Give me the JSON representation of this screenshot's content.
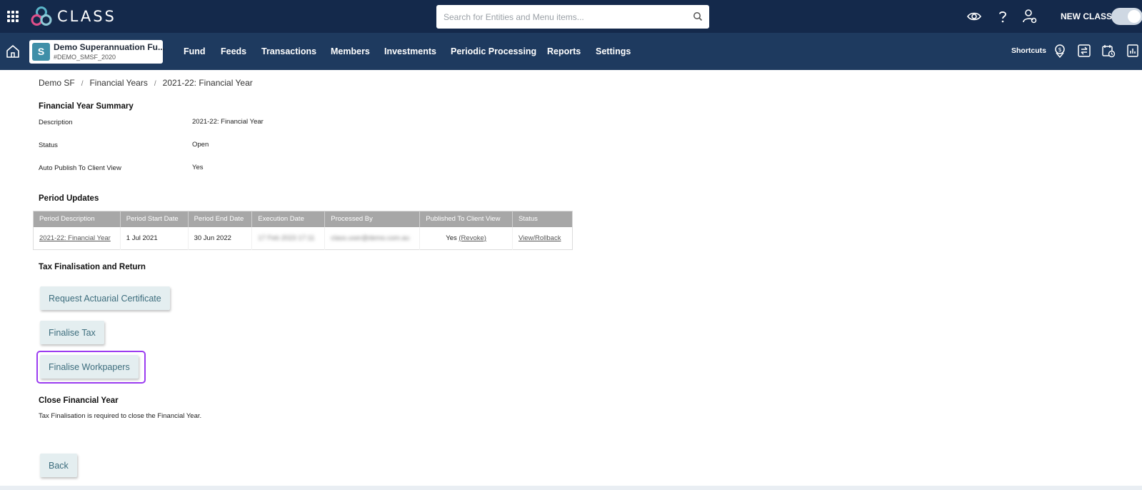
{
  "header": {
    "logo_text": "CLASS",
    "search_placeholder": "Search for Entities and Menu items...",
    "new_class_label": "NEW CLASS",
    "new_class_toggle_on": true
  },
  "nav": {
    "fund_badge": "S",
    "fund_name": "Demo Superannuation Fu...",
    "fund_code": "#DEMO_SMSF_2020",
    "items": [
      "Fund",
      "Feeds",
      "Transactions",
      "Members",
      "Investments",
      "Periodic Processing",
      "Reports",
      "Settings"
    ],
    "shortcuts_label": "Shortcuts"
  },
  "breadcrumb": {
    "items": [
      "Demo SF",
      "Financial Years",
      "2021-22: Financial Year"
    ],
    "separator": "/"
  },
  "summary": {
    "title": "Financial Year Summary",
    "fields": [
      {
        "label": "Description",
        "value": "2021-22: Financial Year"
      },
      {
        "label": "Status",
        "value": "Open"
      },
      {
        "label": "Auto Publish To Client View",
        "value": "Yes"
      }
    ]
  },
  "period_updates": {
    "title": "Period Updates",
    "columns": [
      "Period Description",
      "Period Start Date",
      "Period End Date",
      "Execution Date",
      "Processed By",
      "Published To Client View",
      "Status"
    ],
    "rows": [
      {
        "description": "2021-22: Financial Year",
        "start": "1 Jul 2021",
        "end": "30 Jun 2022",
        "execution_date": "17 Feb 2023 17:11",
        "processed_by": "class.user@demo.com.au",
        "published": "Yes",
        "revoke_label": "(Revoke)",
        "status_link": "View/Rollback"
      }
    ]
  },
  "tax": {
    "title": "Tax Finalisation and Return",
    "request_certificate_label": "Request Actuarial Certificate",
    "finalise_tax_label": "Finalise Tax",
    "finalise_workpapers_label": "Finalise Workpapers"
  },
  "close_year": {
    "title": "Close Financial Year",
    "note": "Tax Finalisation is required to close the Financial Year."
  },
  "back_label": "Back",
  "colors": {
    "topbar": "#14294b",
    "navbar": "#1e3a5f",
    "accent": "#3f8fa8",
    "focus": "#9b3cf0"
  }
}
